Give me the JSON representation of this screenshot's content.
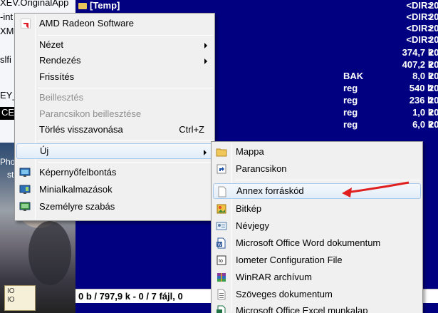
{
  "background_strip": [
    "XEV.OriginalApp",
    "-int",
    "XML",
    "slfi",
    "EY_",
    "CE"
  ],
  "desktop_labels": [
    "Pho",
    "st"
  ],
  "note_lines": [
    "IO",
    "IO"
  ],
  "panel": {
    "rows": [
      {
        "name": "[Temp]",
        "ext": "",
        "size": "<DIR>",
        "date": "20"
      },
      {
        "name": "",
        "ext": "",
        "size": "<DIR>",
        "date": "20"
      },
      {
        "name": "",
        "ext": "",
        "size": "<DIR>",
        "date": "20"
      },
      {
        "name": "",
        "ext": "",
        "size": "<DIR>",
        "date": "20"
      },
      {
        "name": "",
        "ext": "",
        "size": "374,7 k",
        "date": "20"
      },
      {
        "name": "",
        "ext": "",
        "size": "407,2 k",
        "date": "20"
      },
      {
        "name": "",
        "ext": "BAK",
        "size": "8,0 k",
        "date": "20"
      },
      {
        "name": "",
        "ext": "reg",
        "size": "540 b",
        "date": "20"
      },
      {
        "name": "",
        "ext": "reg",
        "size": "236 b",
        "date": "20"
      },
      {
        "name": "",
        "ext": "reg",
        "size": "1,0 k",
        "date": "20"
      },
      {
        "name": "",
        "ext": "reg",
        "size": "6,0 k",
        "date": "20"
      }
    ],
    "status": "0 b / 797,9 k - 0 / 7 fájl, 0"
  },
  "context_menu": {
    "header": "AMD Radeon Software",
    "items": [
      {
        "label": "Nézet",
        "submenu": true
      },
      {
        "label": "Rendezés",
        "submenu": true
      },
      {
        "label": "Frissítés"
      },
      {
        "label": "Beillesztés",
        "disabled": true
      },
      {
        "label": "Parancsikon beillesztése",
        "disabled": true
      },
      {
        "label": "Törlés visszavonása",
        "shortcut": "Ctrl+Z"
      },
      {
        "label": "Új",
        "submenu": true
      },
      {
        "label": "Képernyőfelbontás"
      },
      {
        "label": "Minialkalmazások"
      },
      {
        "label": "Személyre szabás"
      }
    ]
  },
  "new_submenu": {
    "items": [
      {
        "label": "Mappa",
        "icon": "folder-icon"
      },
      {
        "label": "Parancsikon",
        "icon": "shortcut-icon"
      },
      {
        "label": "Annex forráskód",
        "icon": "blank-file-icon"
      },
      {
        "label": "Bitkép",
        "icon": "bitmap-icon"
      },
      {
        "label": "Névjegy",
        "icon": "contact-icon"
      },
      {
        "label": "Microsoft Office Word dokumentum",
        "icon": "word-icon"
      },
      {
        "label": "Iometer Configuration File",
        "icon": "iometer-icon"
      },
      {
        "label": "WinRAR archívum",
        "icon": "winrar-icon"
      },
      {
        "label": "Szöveges dokumentum",
        "icon": "text-file-icon"
      },
      {
        "label": "Microsoft Office Excel munkalap",
        "icon": "excel-icon"
      }
    ]
  },
  "colors": {
    "panel_bg": "#000080",
    "annotation_arrow": "#e02020"
  }
}
